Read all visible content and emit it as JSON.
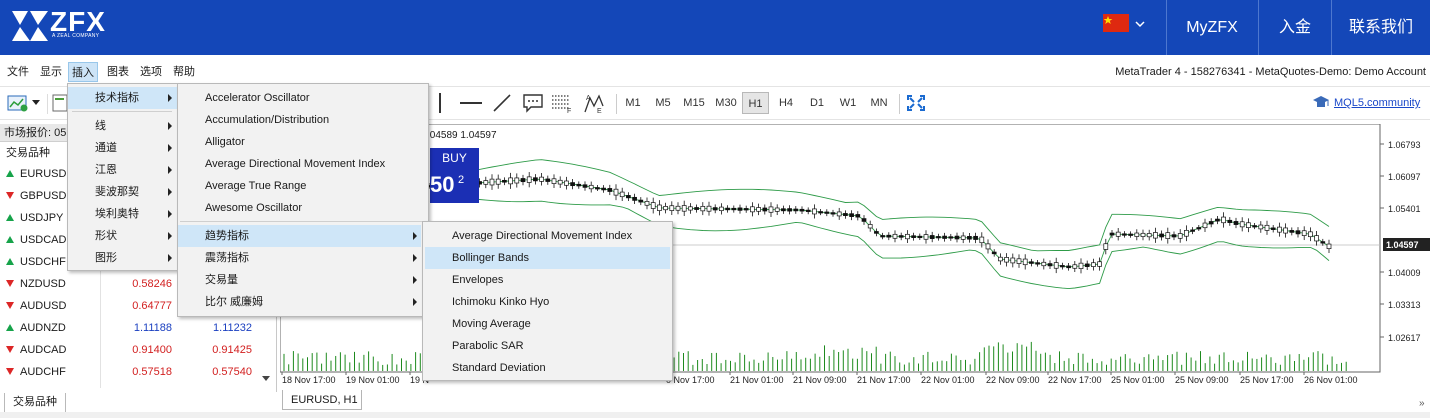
{
  "brand": {
    "logo": "ZFX",
    "tagline": "A ZEAL COMPANY",
    "links": [
      "MyZFX",
      "入金",
      "联系我们"
    ],
    "flag_color": "#de2910",
    "bar_color": "#1447b8"
  },
  "menubar": {
    "items": [
      "文件",
      "显示",
      "插入",
      "图表",
      "选项",
      "帮助"
    ],
    "active": "插入",
    "title": "MetaTrader 4 - 158276341 - MetaQuotes-Demo: Demo Account"
  },
  "toolbar": {
    "timeframes": [
      "M1",
      "M5",
      "M15",
      "M30",
      "H1",
      "H4",
      "D1",
      "W1",
      "MN"
    ],
    "active_timeframe": "H1",
    "mql_link": "MQL5.community"
  },
  "market_watch": {
    "title": "市场报价: 05",
    "column_header": "交易品种",
    "tab": "交易品种",
    "rows": [
      {
        "symbol": "EURUSD",
        "dir": "up",
        "bid": "",
        "ask": ""
      },
      {
        "symbol": "GBPUSD",
        "dir": "down",
        "bid": "",
        "ask": ""
      },
      {
        "symbol": "USDJPY",
        "dir": "up",
        "bid": "",
        "ask": ""
      },
      {
        "symbol": "USDCAD",
        "dir": "up",
        "bid": "",
        "ask": ""
      },
      {
        "symbol": "USDCHF",
        "dir": "up",
        "bid": "",
        "ask": ""
      },
      {
        "symbol": "NZDUSD",
        "dir": "down",
        "bid": "0.58246",
        "ask": ""
      },
      {
        "symbol": "AUDUSD",
        "dir": "down",
        "bid": "0.64777",
        "ask": ""
      },
      {
        "symbol": "AUDNZD",
        "dir": "up",
        "bid": "1.11188",
        "ask": "1.11232"
      },
      {
        "symbol": "AUDCAD",
        "dir": "down",
        "bid": "0.91400",
        "ask": "0.91425"
      },
      {
        "symbol": "AUDCHF",
        "dir": "down",
        "bid": "0.57518",
        "ask": "0.57540"
      }
    ]
  },
  "insert_menu": {
    "items": [
      "技术指标",
      "线",
      "通道",
      "江恩",
      "斐波那契",
      "埃利奥特",
      "形状",
      "图形"
    ],
    "highlighted": "技术指标"
  },
  "indicators_menu": {
    "items": [
      "Accelerator Oscillator",
      "Accumulation/Distribution",
      "Alligator",
      "Average Directional Movement Index",
      "Average True Range",
      "Awesome Oscillator"
    ],
    "groups": [
      "趋势指标",
      "震荡指标",
      "交易量",
      "比尔 威廉姆"
    ],
    "highlighted_group": "趋势指标"
  },
  "trend_menu": {
    "items": [
      "Average Directional Movement Index",
      "Bollinger Bands",
      "Envelopes",
      "Ichimoku Kinko Hyo",
      "Moving Average",
      "Parabolic SAR",
      "Standard Deviation"
    ],
    "highlighted": "Bollinger Bands"
  },
  "chart": {
    "tab": "EURUSD, H1",
    "ohlc_text": ".04589 1.04597",
    "buy_label": "BUY",
    "buy_price": "50",
    "buy_sup": "2",
    "price_labels": [
      "1.06793",
      "1.06097",
      "1.05401",
      "1.04597",
      "1.04009",
      "1.03313",
      "1.02617"
    ],
    "current_price": "1.04597",
    "time_labels": [
      "18 Nov 17:00",
      "19 Nov 01:00",
      "19 N",
      "21 Nov 01:00",
      "21 Nov 09:00",
      "21 Nov 17:00",
      "22 Nov 01:00",
      "22 Nov 09:00",
      "22 Nov 17:00",
      "25 Nov 01:00",
      "25 Nov 09:00",
      "25 Nov 17:00",
      "26 Nov 01:00"
    ],
    "partial_time_label": "0 Nov 17:00",
    "band_color": "#2e9b48",
    "volume_color": "#1e8a1e"
  }
}
